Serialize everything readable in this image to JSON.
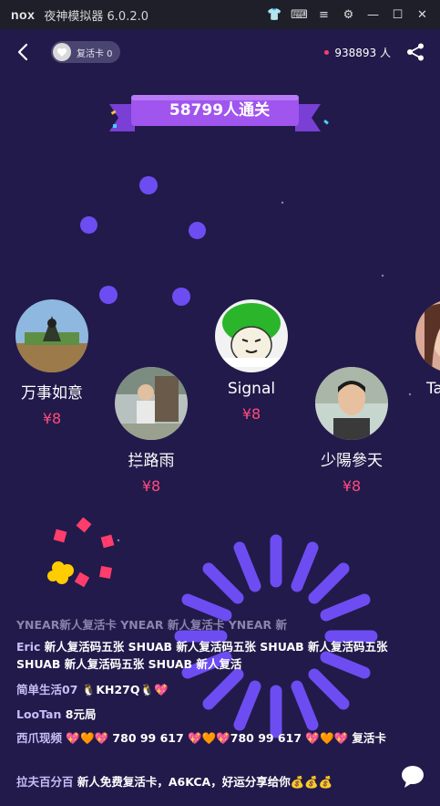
{
  "titlebar": {
    "logo": "nox",
    "title": "夜神模拟器 6.0.2.0"
  },
  "topbar": {
    "revive_label": "复活卡 0",
    "online_count": "938893 人"
  },
  "banner": {
    "text": "58799人通关"
  },
  "winners": [
    {
      "name": "万事如意",
      "amount": "¥8"
    },
    {
      "name": "拦路雨",
      "amount": "¥8"
    },
    {
      "name": "Signal",
      "amount": "¥8"
    },
    {
      "name": "少陽參天",
      "amount": "¥8"
    },
    {
      "name": "Ta",
      "amount": ""
    }
  ],
  "ghost_line": "YNEAR新人复活卡 YNEAR 新人复活卡 YNEAR 新",
  "chat": [
    {
      "user": "Eric",
      "message": "新人复活码五张 SHUAB 新人复活码五张 SHUAB 新人复活码五张 SHUAB 新人复活码五张 SHUAB 新人复活"
    },
    {
      "user": "简单生活07",
      "message": "🐧KH27Q🐧💖"
    },
    {
      "user": "LooTan",
      "message": "8元局"
    },
    {
      "user": "西爪现频",
      "message": "💖🧡💖 780 99 617 💖🧡💖780 99 617 💖🧡💖 复活卡"
    },
    {
      "user": "拉夫百分百",
      "message": "新人免费复活卡，A6KCA，好运分享给你💰💰💰"
    }
  ],
  "colors": {
    "background": "#221a4a",
    "accent_pink": "#ff4b7d",
    "ball": "#6d4df2",
    "banner": "#a055ee"
  }
}
